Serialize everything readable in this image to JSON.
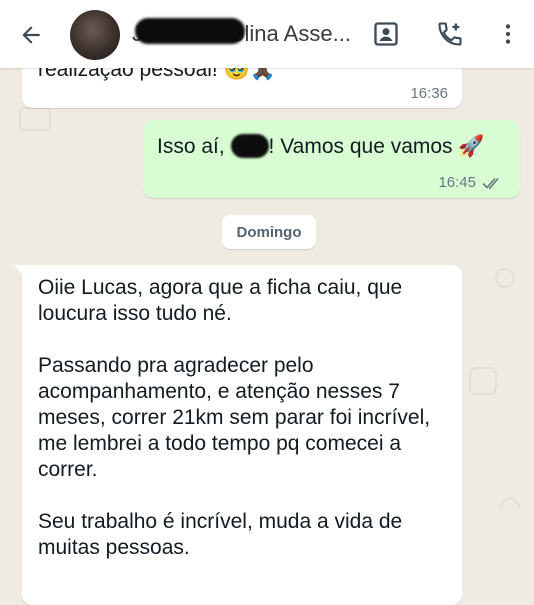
{
  "header": {
    "contact_name": "Joana Karolina Asse..."
  },
  "messages": [
    {
      "id": "m1",
      "direction": "incoming",
      "text": "realização pessoal! 🥹🙏🏿",
      "time": "16:36"
    },
    {
      "id": "m2",
      "direction": "outgoing",
      "text_before": "Isso aí, ",
      "text_after": "! Vamos que vamos 🚀",
      "time": "16:45",
      "status": "read"
    }
  ],
  "day_separator": "Domingo",
  "message3": {
    "direction": "incoming",
    "paragraphs": [
      "Oiie Lucas, agora que a ficha caiu, que loucura isso tudo né.",
      " Passando pra agradecer pelo acompanhamento, e atenção nesses 7 meses, correr 21km sem parar foi incrível, me lembrei a todo tempo pq comecei a correr.",
      "Seu trabalho é incrível, muda a vida de muitas pessoas."
    ]
  },
  "icons": {
    "back": "arrow-left-icon",
    "contact_card": "contact-card-icon",
    "add_call": "phone-plus-icon",
    "more": "more-vertical-icon",
    "read_receipt": "double-check-icon"
  },
  "colors": {
    "wallpaper": "#efeae2",
    "incoming_bubble": "#ffffff",
    "outgoing_bubble": "#d9fdd3",
    "read_check": "#53bdeb"
  }
}
